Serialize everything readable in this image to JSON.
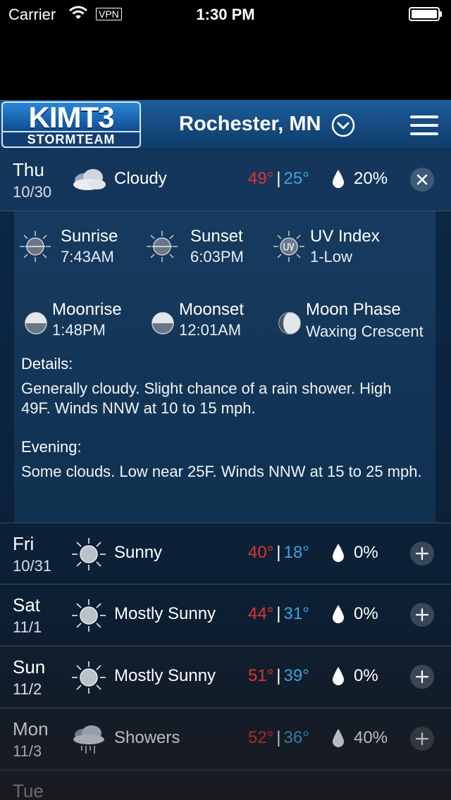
{
  "status_bar": {
    "carrier": "Carrier",
    "vpn": "VPN",
    "time": "1:30 PM"
  },
  "header": {
    "logo_top": "KIMT3",
    "logo_bottom": "STORMTEAM",
    "location": "Rochester, MN",
    "icons": [
      "chevron-down-circle-icon",
      "hamburger-menu-icon"
    ]
  },
  "colors": {
    "high_temp": "#e0332f",
    "low_temp": "#3aa3e6",
    "header_blue": "#1d5c97"
  },
  "days": [
    {
      "day": "Thu",
      "date": "10/30",
      "icon": "cloudy-icon",
      "condition": "Cloudy",
      "high": "49°",
      "low": "25°",
      "precip": "20%",
      "state": "expanded"
    },
    {
      "day": "Fri",
      "date": "10/31",
      "icon": "sunny-icon",
      "condition": "Sunny",
      "high": "40°",
      "low": "18°",
      "precip": "0%",
      "state": "collapsed"
    },
    {
      "day": "Sat",
      "date": "11/1",
      "icon": "sunny-icon",
      "condition": "Mostly Sunny",
      "high": "44°",
      "low": "31°",
      "precip": "0%",
      "state": "collapsed"
    },
    {
      "day": "Sun",
      "date": "11/2",
      "icon": "sunny-icon",
      "condition": "Mostly Sunny",
      "high": "51°",
      "low": "39°",
      "precip": "0%",
      "state": "collapsed"
    },
    {
      "day": "Mon",
      "date": "11/3",
      "icon": "showers-icon",
      "condition": "Showers",
      "high": "52°",
      "low": "36°",
      "precip": "40%",
      "state": "collapsed"
    },
    {
      "day": "Tue",
      "state": "collapsed"
    }
  ],
  "detail": {
    "sunrise": {
      "label": "Sunrise",
      "value": "7:43AM"
    },
    "sunset": {
      "label": "Sunset",
      "value": "6:03PM"
    },
    "uv": {
      "label": "UV Index",
      "value": "1-Low"
    },
    "moonrise": {
      "label": "Moonrise",
      "value": "1:48PM"
    },
    "moonset": {
      "label": "Moonset",
      "value": "12:01AM"
    },
    "moon_phase": {
      "label": "Moon Phase",
      "value": "Waxing Crescent"
    },
    "details_heading": "Details:",
    "details_text": "Generally cloudy. Slight chance of a rain shower. High 49F. Winds NNW at 10 to 15 mph.",
    "evening_heading": "Evening:",
    "evening_text": "Some clouds. Low near 25F. Winds NNW at 15 to 25 mph."
  }
}
